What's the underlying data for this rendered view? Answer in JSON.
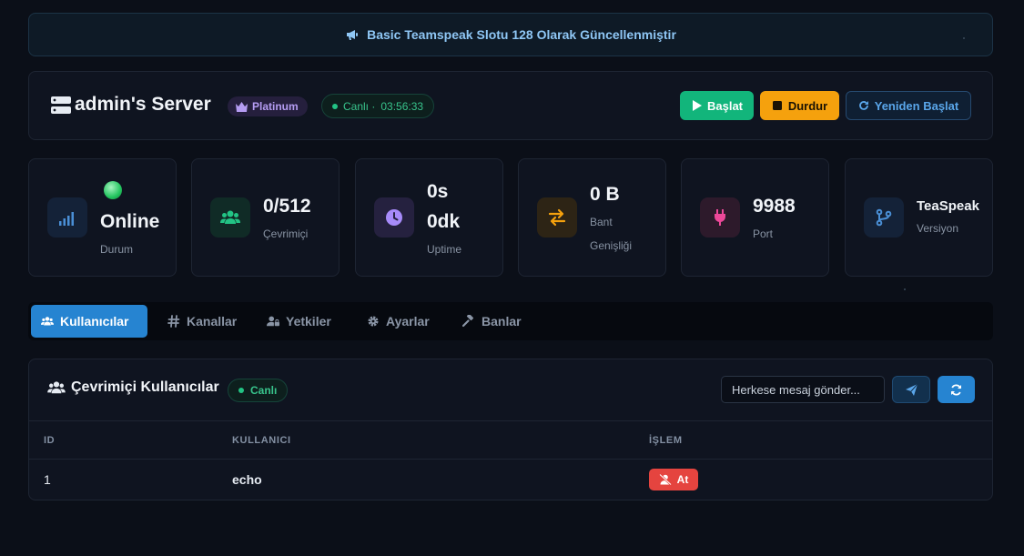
{
  "announcement": {
    "icon": "megaphone-icon",
    "text": "Basic Teamspeak Slotu 128 Olarak Güncellenmiştir"
  },
  "server": {
    "title": "admin's Server",
    "plan_badge": "Platinum",
    "live_label": "Canlı ·",
    "live_time": "03:56:33",
    "buttons": {
      "start": "Başlat",
      "stop": "Durdur",
      "restart": "Yeniden Başlat"
    }
  },
  "stats": [
    {
      "icon": "signal-icon",
      "value": "Online",
      "label": "Durum",
      "indicator_color": "#4ade80"
    },
    {
      "icon": "users-icon",
      "value": "0/512",
      "label": "Çevrimiçi"
    },
    {
      "icon": "clock-icon",
      "value_line1": "0s",
      "value_line2": "0dk",
      "label": "Uptime"
    },
    {
      "icon": "exchange-icon",
      "value": "0 B",
      "label_line1": "Bant",
      "label_line2": "Genişliği"
    },
    {
      "icon": "plug-icon",
      "value": "9988",
      "label": "Port"
    },
    {
      "icon": "code-branch-icon",
      "value": "TeaSpeak",
      "label": "Versiyon"
    }
  ],
  "tabs": [
    {
      "label": "Kullanıcılar",
      "icon": "users-icon",
      "active": true
    },
    {
      "label": "Kanallar",
      "icon": "hash-icon",
      "active": false
    },
    {
      "label": "Yetkiler",
      "icon": "user-lock-icon",
      "active": false
    },
    {
      "label": "Ayarlar",
      "icon": "gear-icon",
      "active": false
    },
    {
      "label": "Banlar",
      "icon": "gavel-icon",
      "active": false
    }
  ],
  "online_users": {
    "title": "Çevrimiçi Kullanıcılar",
    "live_badge": "Canlı",
    "message_placeholder": "Herkese mesaj gönder...",
    "columns": [
      "ID",
      "KULLANICI",
      "İŞLEM"
    ],
    "rows": [
      {
        "id": "1",
        "user": "echo",
        "action": "At"
      }
    ]
  },
  "colors": {
    "accent": "#2684d1",
    "success": "#12b57b",
    "warning": "#f5a10d",
    "danger": "#e5443f",
    "background": "#0b0f18",
    "card": "#0f1420"
  }
}
